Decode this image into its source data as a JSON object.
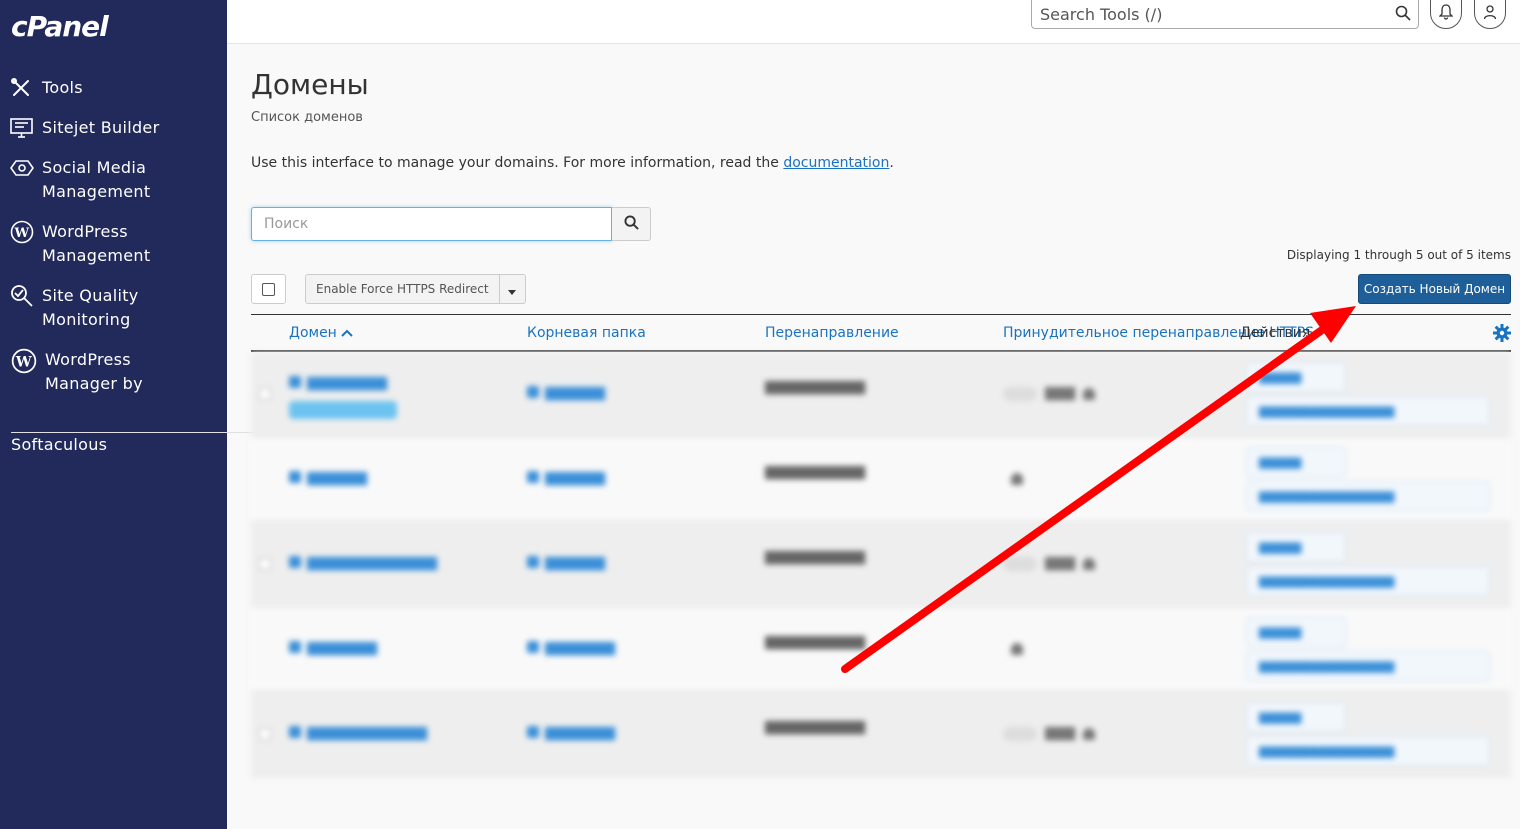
{
  "sidebar": {
    "logo": "cPanel",
    "items": [
      {
        "label": "Tools",
        "icon": "tools-icon"
      },
      {
        "label": "Sitejet Builder",
        "icon": "sitejet-icon"
      },
      {
        "label": "Social Media Management",
        "icon": "social-media-icon"
      },
      {
        "label": "WordPress Management",
        "icon": "wordpress-icon"
      },
      {
        "label": "Site Quality Monitoring",
        "icon": "site-quality-icon"
      },
      {
        "label": "WordPress Manager by Softaculous",
        "icon": "wordpress-icon"
      }
    ],
    "softaculous_line1": "WordPress",
    "softaculous_line2": "Manager by",
    "softaculous_line3": "Softaculous",
    "social_line1": "Social Media",
    "social_line2": "Management",
    "wp_line1": "WordPress",
    "wp_line2": "Management",
    "sq_line1": "Site Quality",
    "sq_line2": "Monitoring"
  },
  "topbar": {
    "search_placeholder": "Search Tools (/)"
  },
  "page": {
    "title": "Домены",
    "subtitle": "Список доменов",
    "description": "Use this interface to manage your domains. For more information, read the ",
    "doc_link": "documentation",
    "desc_end": "."
  },
  "search": {
    "placeholder": "Поиск"
  },
  "displaying": "Displaying 1 through 5 out of 5 items",
  "toolbar": {
    "force_https": "Enable Force HTTPS Redirect",
    "create_domain": "Создать Новый Домен"
  },
  "table": {
    "columns": {
      "domain": "Домен",
      "root": "Корневая папка",
      "redirect": "Перенаправление",
      "force": "Принудительное перенаправление HTTPS",
      "actions": "Действия"
    }
  },
  "colors": {
    "sidebar": "#212a5a",
    "accent": "#1e5f99",
    "link": "#1a73c1",
    "arrow": "#ff0000"
  }
}
